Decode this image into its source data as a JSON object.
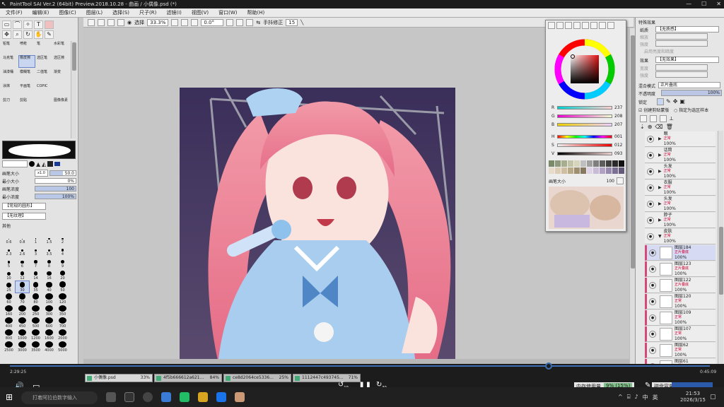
{
  "window": {
    "title": "PaintTool SAI Ver.2 (64bit) Preview.2018.10.28 - 曲画 / 小偶像.psd (*)"
  },
  "menu": [
    "文件(F)",
    "编辑(E)",
    "图像(C)",
    "图层(L)",
    "选择(S)",
    "尺子(R)",
    "滤镜(I)",
    "视图(V)",
    "窗口(W)",
    "帮助(H)"
  ],
  "toolbar": {
    "select_label": "选择",
    "zoom": "33.3%",
    "angle": "0.0°",
    "stabilizer_label": "手抖修正",
    "stabilizer": "15"
  },
  "brushes": [
    "铅笔",
    "喷枪",
    "笔",
    "水彩笔",
    "马克笔",
    "橡皮擦",
    "选区笔",
    "选区擦",
    "油漆桶",
    "模糊笔",
    "二值笔",
    "渐变",
    "涂抹",
    "平画笔",
    "COPIC",
    "",
    "剪刀",
    "剪贴",
    "",
    "图像像素"
  ],
  "brush_props": [
    {
      "label": "画笔大小",
      "prefix": "x1.0",
      "value": "50.0",
      "fill": 0.5
    },
    {
      "label": "最小大小",
      "value": "0%",
      "fill": 0
    },
    {
      "label": "画笔浓度",
      "value": "100",
      "fill": 1
    },
    {
      "label": "最小浓度",
      "value": "100%",
      "fill": 1
    }
  ],
  "shape_label": "【常规的圆形】",
  "texture_label": "【无纹理】",
  "other_label": "其他",
  "sizes": [
    "0.6",
    "0.8",
    "1",
    "1.5",
    "2",
    "2.3",
    "2.6",
    "3",
    "3.5",
    "4",
    "5",
    "6",
    "7",
    "8",
    "9",
    "10",
    "12",
    "14",
    "16",
    "20",
    "25",
    "30",
    "35",
    "40",
    "50",
    "60",
    "70",
    "80",
    "100",
    "120",
    "160",
    "200",
    "250",
    "300",
    "350",
    "400",
    "450",
    "500",
    "600",
    "700",
    "800",
    "1000",
    "1200",
    "1600",
    "2000",
    "2500",
    "3000",
    "3500",
    "4000",
    "5000"
  ],
  "effects": {
    "title": "特殊效果",
    "texture_label": "纸质",
    "texture_value": "【无质感】",
    "scale_label": "缩放",
    "strength_label": "强度",
    "brightness_label": "亮度",
    "effect_label": "效果",
    "effect_value": "【无效果】",
    "width_label": "宽度",
    "strength2_label": "强度",
    "use_brightness_label": "启用亮度和暗度"
  },
  "layer_props": {
    "blend_label": "混合模式",
    "blend_value": "正片叠底",
    "opacity_label": "不透明度",
    "opacity_value": "100%",
    "lock_label": "锁定",
    "clip_label": "创建剪贴蒙版",
    "ref_label": "指定为选区样本"
  },
  "layers": [
    {
      "name": "眼",
      "mode": "正常",
      "opacity": "100%",
      "folder": true
    },
    {
      "name": "话筒",
      "mode": "正常",
      "opacity": "100%",
      "folder": true
    },
    {
      "name": "头发",
      "mode": "正常",
      "opacity": "100%",
      "folder": true
    },
    {
      "name": "衣服",
      "mode": "正常",
      "opacity": "100%",
      "folder": true
    },
    {
      "name": "头发",
      "mode": "正常",
      "opacity": "100%",
      "folder": true
    },
    {
      "name": "脖子",
      "mode": "正常",
      "opacity": "100%",
      "folder": true
    },
    {
      "name": "皮肤",
      "mode": "正常",
      "opacity": "100%",
      "folder": true,
      "open": true
    },
    {
      "name": "图层184",
      "mode": "正片叠底",
      "opacity": "100%",
      "selected": true
    },
    {
      "name": "图层123",
      "mode": "正片叠底",
      "opacity": "100%"
    },
    {
      "name": "图层122",
      "mode": "正片叠底",
      "opacity": "100%"
    },
    {
      "name": "图层120",
      "mode": "正常",
      "opacity": "100%"
    },
    {
      "name": "图层109",
      "mode": "正常",
      "opacity": "100%"
    },
    {
      "name": "图层107",
      "mode": "正常",
      "opacity": "100%"
    },
    {
      "name": "图层62",
      "mode": "正常",
      "opacity": "100%"
    },
    {
      "name": "图层61",
      "mode": "正常",
      "opacity": "100%"
    }
  ],
  "color": {
    "R": "237",
    "G": "208",
    "B": "207",
    "H": "001",
    "S": "012",
    "V": "093",
    "swatch_label": "画笔大小",
    "swatch_value": "100",
    "current_hex": "#EDD0CF"
  },
  "doc_tabs": [
    {
      "name": "小偶像.psd",
      "pct": "33%"
    },
    {
      "name": "4f5b666612a621...",
      "pct": "84%"
    },
    {
      "name": "ce8d2064ce5336...",
      "pct": "25%"
    },
    {
      "name": "1112447c493745...",
      "pct": "71%"
    }
  ],
  "status": {
    "memory_label": "内存使用量",
    "memory_value": "9% (15%)",
    "disk_label": "磁盘容量",
    "disk_value": "9%"
  },
  "video": {
    "current": "2:29:25",
    "total": "0:45:09",
    "progress": 0.77,
    "skip_back": "10",
    "skip_fwd": "30"
  },
  "taskbar": {
    "search_placeholder": "打着阿拉伯数字输入",
    "lang": "英",
    "time": "21:53",
    "date": "2026/3/15"
  },
  "accent": "#3c6db0"
}
